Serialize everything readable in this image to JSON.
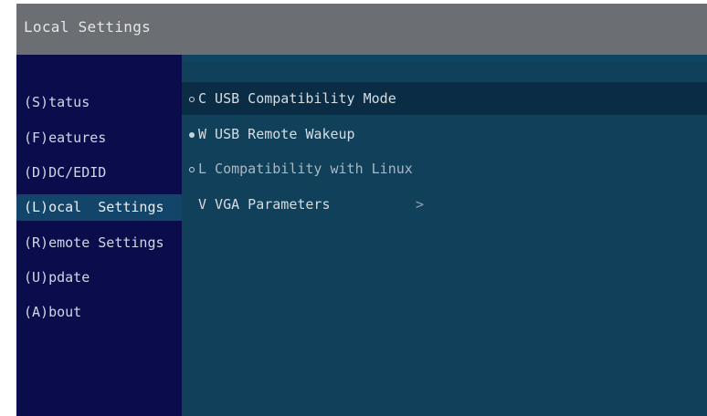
{
  "window": {
    "title": "Local Settings"
  },
  "sidebar": {
    "items": [
      {
        "label": "(S)tatus",
        "active": false
      },
      {
        "label": "(F)eatures",
        "active": false
      },
      {
        "label": "(D)DC/EDID",
        "active": false
      },
      {
        "label": "(L)ocal  Settings",
        "active": true
      },
      {
        "label": "(R)emote Settings",
        "active": false
      },
      {
        "label": "(U)pdate",
        "active": false
      },
      {
        "label": "(A)bout",
        "active": false
      }
    ]
  },
  "options": [
    {
      "label": "C USB Compatibility Mode",
      "state": "unchecked",
      "selected": true
    },
    {
      "label": "W USB Remote Wakeup",
      "state": "checked",
      "selected": false
    },
    {
      "label": "L Compatibility with Linux",
      "state": "unchecked",
      "selected": false
    },
    {
      "label": "V VGA Parameters",
      "state": "submenu",
      "selected": false,
      "chevron": ">"
    }
  ],
  "colors": {
    "titlebar": "#6b6e72",
    "sidebar": "#0a0c4c",
    "content": "#10405a",
    "selection": "#0a2d45",
    "active_nav": "#13456a"
  }
}
